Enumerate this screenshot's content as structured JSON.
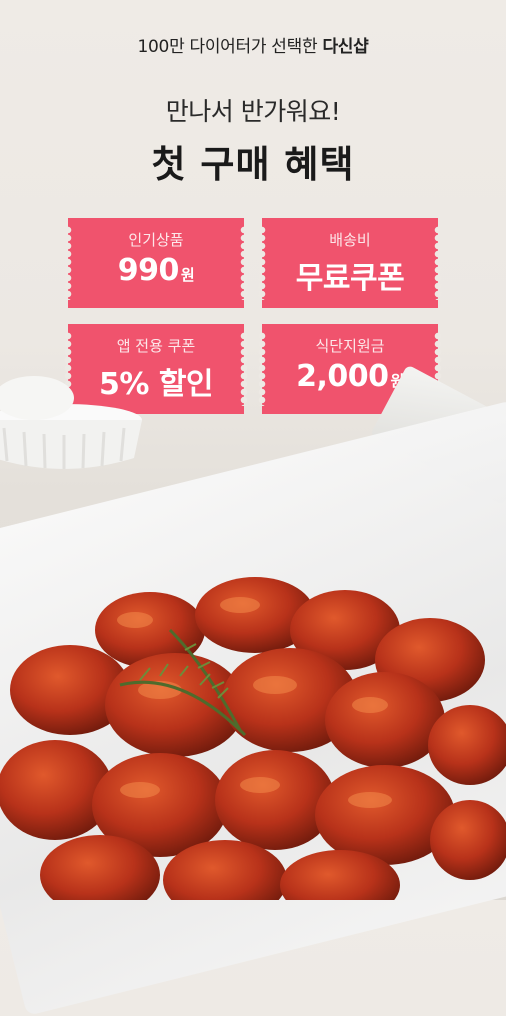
{
  "header": {
    "tagline_prefix": "100만 다이어터가 선택한",
    "tagline_brand": "다신샵",
    "greeting": "만나서 반가워요!",
    "headline": "첫 구매 혜택"
  },
  "benefits": [
    {
      "label": "인기상품",
      "value": "990",
      "unit": "원"
    },
    {
      "label": "배송비",
      "value": "무료쿠폰",
      "unit": ""
    },
    {
      "label": "앱 전용 쿠폰",
      "value": "5% 할인",
      "unit": ""
    },
    {
      "label": "식단지원금",
      "value": "2,000",
      "unit": "원"
    }
  ],
  "colors": {
    "ticket": "#f0536d",
    "background": "#efebe6",
    "sauce": "#b8321a"
  },
  "image": {
    "subject": "glazed-fried-chicken-icon",
    "props": [
      "ramekin-icon",
      "rosemary-icon",
      "parchment-paper-icon"
    ]
  }
}
